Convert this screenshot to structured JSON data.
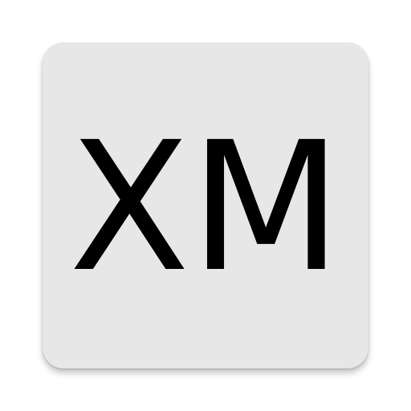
{
  "app_icon": {
    "monogram": "XM",
    "colors": {
      "background": "#e7e7e7",
      "foreground": "#000000"
    }
  }
}
